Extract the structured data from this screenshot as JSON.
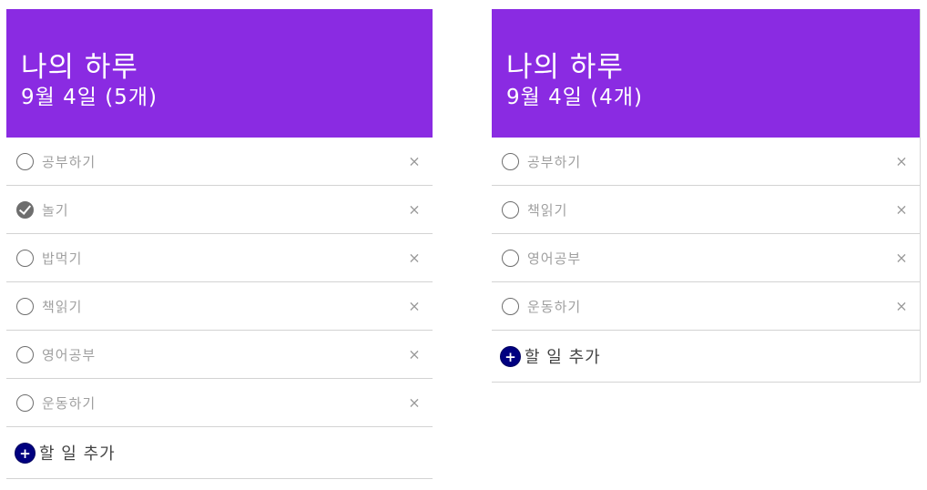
{
  "left_panel": {
    "title": "나의 하루",
    "subtitle": "9월 4일 (5개)",
    "items": [
      {
        "label": "공부하기",
        "done": false
      },
      {
        "label": "놀기",
        "done": true
      },
      {
        "label": "밥먹기",
        "done": false
      },
      {
        "label": "책읽기",
        "done": false
      },
      {
        "label": "영어공부",
        "done": false
      },
      {
        "label": "운동하기",
        "done": false
      }
    ],
    "add_label": "할 일 추가"
  },
  "right_panel": {
    "title": "나의 하루",
    "subtitle": "9월 4일 (4개)",
    "items": [
      {
        "label": "공부하기",
        "done": false
      },
      {
        "label": "책읽기",
        "done": false
      },
      {
        "label": "영어공부",
        "done": false
      },
      {
        "label": "운동하기",
        "done": false
      }
    ],
    "add_label": "할 일 추가"
  },
  "icons": {
    "delete": "×",
    "add": "+"
  },
  "colors": {
    "header_bg": "#8a2be2",
    "add_button": "#000080",
    "checked": "#6e6e6e"
  }
}
